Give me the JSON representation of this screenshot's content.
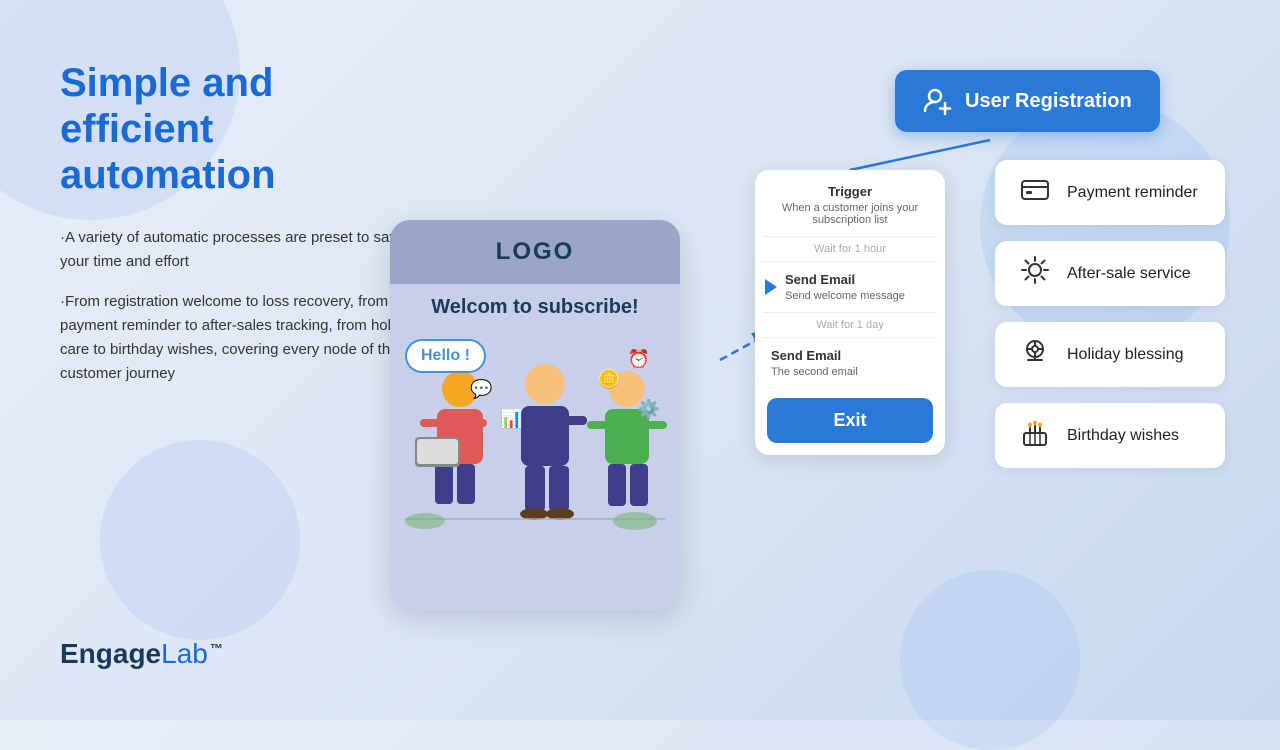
{
  "page": {
    "background": "#dce6f5"
  },
  "hero": {
    "title_line1": "Simple and efficient",
    "title_line2": "automation",
    "desc1": "·A variety of automatic processes are preset to save your time and effort",
    "desc2": "·From registration welcome to loss recovery, from payment reminder to after-sales tracking, from holiday care to birthday wishes, covering every node of the customer journey"
  },
  "logo": {
    "engage": "Engage",
    "lab": "Lab",
    "tm": "™"
  },
  "phone": {
    "logo": "LOGO",
    "welcome": "Welcom to subscribe!",
    "hello": "Hello !"
  },
  "user_registration": {
    "label": "User Registration"
  },
  "flow": {
    "trigger_title": "Trigger",
    "trigger_sub": "When a customer joins your subscription list",
    "wait1": "Wait for 1 hour",
    "email1_title": "Send Email",
    "email1_sub": "Send welcome message",
    "wait2": "Wait for 1 day",
    "email2_title": "Send Email",
    "email2_sub": "The second email",
    "exit": "Exit"
  },
  "sidebar": {
    "items": [
      {
        "id": "payment",
        "label": "Payment reminder",
        "icon": "💳"
      },
      {
        "id": "aftersale",
        "label": "After-sale service",
        "icon": "🔧"
      },
      {
        "id": "holiday",
        "label": "Holiday blessing",
        "icon": "🎁"
      },
      {
        "id": "birthday",
        "label": "Birthday wishes",
        "icon": "🎂"
      }
    ]
  }
}
